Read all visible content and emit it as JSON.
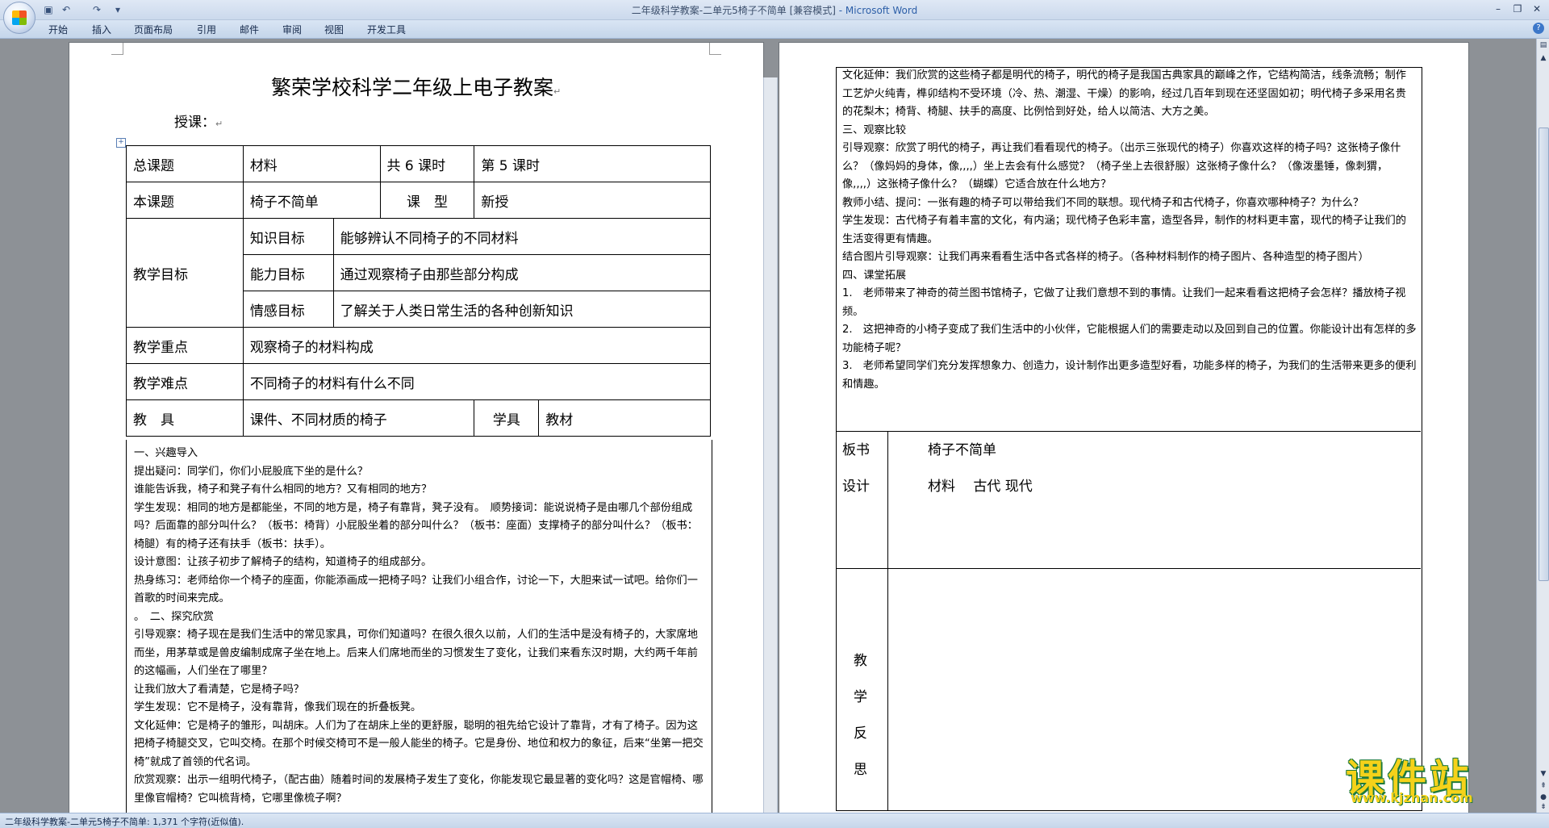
{
  "window": {
    "title": "二年级科学教案-二单元5椅子不简单 [兼容模式]",
    "app": " - Microsoft Word"
  },
  "ribbon": {
    "tabs": [
      "开始",
      "插入",
      "页面布局",
      "引用",
      "邮件",
      "审阅",
      "视图",
      "开发工具"
    ]
  },
  "page_left": {
    "title": "繁荣学校科学二年级上电子教案",
    "teacher_label": "授课：",
    "table": {
      "r1": [
        "总课题",
        "材料",
        "共 6 课时",
        "第  5 课时"
      ],
      "r2": [
        "本课题",
        "椅子不简单",
        "课　型",
        "新授"
      ],
      "goals_label": "教学目标",
      "goals": [
        {
          "k": "知识目标",
          "v": "能够辨认不同椅子的不同材料"
        },
        {
          "k": "能力目标",
          "v": "通过观察椅子由那些部分构成"
        },
        {
          "k": "情感目标",
          "v": "了解关于人类日常生活的各种创新知识"
        }
      ],
      "focus": [
        "教学重点",
        "观察椅子的材料构成"
      ],
      "difficulty": [
        "教学难点",
        "不同椅子的材料有什么不同"
      ],
      "tools": [
        "教　具",
        "课件、不同材质的椅子",
        "学具",
        "教材"
      ]
    },
    "body": [
      "一、兴趣导入",
      "提出疑问：同学们，你们小屁股底下坐的是什么？",
      "谁能告诉我，椅子和凳子有什么相同的地方？又有相同的地方？",
      "学生发现：相同的地方是都能坐，不同的地方是，椅子有靠背，凳子没有。　顺势接词：能说说椅子是由哪几个部份组成吗？后面靠的部分叫什么？（板书：椅背）小屁股坐着的部分叫什么？（板书：座面）支撑椅子的部分叫什么？（板书：椅腿）有的椅子还有扶手（板书：扶手）。",
      "设计意图：让孩子初步了解椅子的结构，知道椅子的组成部分。",
      "热身练习：老师给你一个椅子的座面，你能添画成一把椅子吗？让我们小组合作，讨论一下，大胆来试一试吧。给你们一首歌的时间来完成。",
      "。　二、探究欣赏",
      "引导观察：椅子现在是我们生活中的常见家具，可你们知道吗？在很久很久以前，人们的生活中是没有椅子的，大家席地而坐，用茅草或是兽皮编制成席子坐在地上。后来人们席地而坐的习惯发生了变化，让我们来看东汉时期，大约两千年前的这幅画，人们坐在了哪里？",
      "让我们放大了看清楚，它是椅子吗？",
      "学生发现：它不是椅子，没有靠背，像我们现在的折叠板凳。",
      "文化延伸：它是椅子的雏形，叫胡床。人们为了在胡床上坐的更舒服，聪明的祖先给它设计了靠背，才有了椅子。因为这把椅子椅腿交叉，它叫交椅。在那个时候交椅可不是一般人能坐的椅子。它是身份、地位和权力的象征，后来“坐第一把交椅”就成了首领的代名词。",
      "欣赏观察：出示一组明代椅子，（配古曲）随着时间的发展椅子发生了变化，你能发现它最显著的变化吗？这是官帽椅、哪里像官帽椅？它叫梳背椅，它哪里像梳子啊？"
    ]
  },
  "page_right": {
    "body": [
      "文化延伸：我们欣赏的这些椅子都是明代的椅子，明代的椅子是我国古典家具的巅峰之作，它结构简洁，线条流畅；制作工艺炉火纯青，榫卯结构不受环境（冷、热、潮湿、干燥）的影响，经过几百年到现在还坚固如初；明代椅子多采用名贵的花梨木；椅背、椅腿、扶手的高度、比例恰到好处，给人以简洁、大方之美。",
      "三、观察比较",
      "引导观察：欣赏了明代的椅子，再让我们看看现代的椅子。（出示三张现代的椅子）你喜欢这样的椅子吗？这张椅子像什么？（像妈妈的身体，像,,,,）坐上去会有什么感觉？（椅子坐上去很舒服）这张椅子像什么？（像泼墨锤，像刺猬，像,,,,）这张椅子像什么？（蝴蝶）它适合放在什么地方？",
      "教师小结、提问：一张有趣的椅子可以带给我们不同的联想。现代椅子和古代椅子，你喜欢哪种椅子？为什么？",
      "学生发现：古代椅子有着丰富的文化，有内涵；现代椅子色彩丰富，造型各异，制作的材料更丰富，现代的椅子让我们的生活变得更有情趣。",
      "结合图片引导观察：让我们再来看看生活中各式各样的椅子。（各种材料制作的椅子图片、各种造型的椅子图片）",
      "四、课堂拓展",
      "1.　老师带来了神奇的荷兰图书馆椅子，它做了让我们意想不到的事情。让我们一起来看看这把椅子会怎样？播放椅子视频。",
      "2.　这把神奇的小椅子变成了我们生活中的小伙伴，它能根据人们的需要走动以及回到自己的位置。你能设计出有怎样的多功能椅子呢？",
      "3.　老师希望同学们充分发挥想象力、创造力，设计制作出更多造型好看，功能多样的椅子，为我们的生活带来更多的便利和情趣。"
    ],
    "board_label": [
      "板书",
      "设计"
    ],
    "board_content": [
      "椅子不简单",
      "材料　 古代  现代"
    ],
    "reflection_label": [
      "教",
      "学",
      "反",
      "思"
    ]
  },
  "status": {
    "text": "二年级科学教案-二单元5椅子不简单: 1,371 个字符(近似值)."
  },
  "watermark": {
    "main": "课件站",
    "url": "www.kjzhan.com"
  }
}
